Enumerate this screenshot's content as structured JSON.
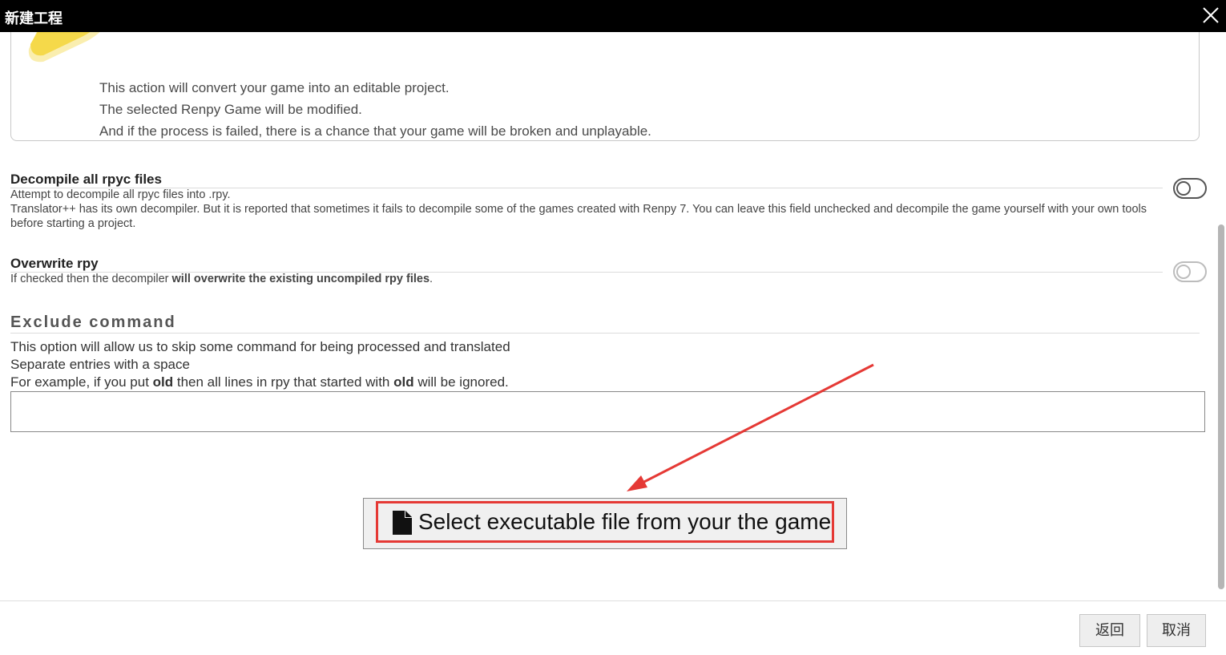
{
  "window": {
    "title": "新建工程",
    "close_icon": "close-icon"
  },
  "warning": {
    "icon": "warning-icon",
    "lines": [
      "This action will convert your game into an editable project.",
      "The selected Renpy Game will be modified.",
      "And if the process is failed, there is a chance that your game will be broken and unplayable."
    ]
  },
  "options": {
    "decompile": {
      "title": "Decompile all rpyc files",
      "desc_line1": "Attempt to decompile all rpyc files into .rpy.",
      "desc_line2": "Translator++ has its own decompiler. But it is reported that sometimes it fails to decompile some of the games created with Renpy 7. You can leave this field unchecked and decompile the game yourself with your own tools before starting a project.",
      "checked": false
    },
    "overwrite": {
      "title": "Overwrite rpy",
      "desc_prefix": "If checked then the decompiler ",
      "desc_bold": "will overwrite the existing uncompiled rpy files",
      "desc_suffix": ".",
      "checked": false,
      "disabled": true
    }
  },
  "exclude": {
    "title": "Exclude command",
    "line1": "This option will allow us to skip some command for being processed and translated",
    "line2": "Separate entries with a space",
    "line3_a": "For example, if you put ",
    "line3_b": "old",
    "line3_c": " then all lines in rpy that started with ",
    "line3_d": "old",
    "line3_e": " will be ignored.",
    "value": ""
  },
  "select_button": {
    "label": "Select executable file from your the game",
    "icon": "file-icon",
    "highlight_color": "#e53935"
  },
  "annotation": {
    "arrow_color": "#e53935"
  },
  "footer": {
    "back_label": "返回",
    "cancel_label": "取消"
  }
}
